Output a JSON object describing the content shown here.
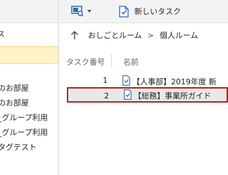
{
  "left_pane": {
    "header_text": "ス",
    "tree_items": [
      "のお部屋",
      "のお部屋",
      "_グループ利用",
      "_グループ利用",
      "タグテスト"
    ]
  },
  "toolbar": {
    "view_icon": "view-switch-icon",
    "new_task_label": "新しいタスク"
  },
  "breadcrumb": {
    "up_icon": "arrow-up-icon",
    "path": [
      "おしごとルーム",
      "個人ルーム"
    ],
    "separator": ">"
  },
  "table": {
    "headers": {
      "number": "タスク番号",
      "name": "名前"
    },
    "rows": [
      {
        "number": "1",
        "name": "【人事部】2019年度 新"
      },
      {
        "number": "2",
        "name": "【総務】事業所ガイド"
      }
    ]
  },
  "colors": {
    "selected_left_bg": "#fdf3c4",
    "selected_row_border": "#b22222",
    "selected_row_bg": "#e8e8e8",
    "icon_blue": "#2b6cb0"
  }
}
